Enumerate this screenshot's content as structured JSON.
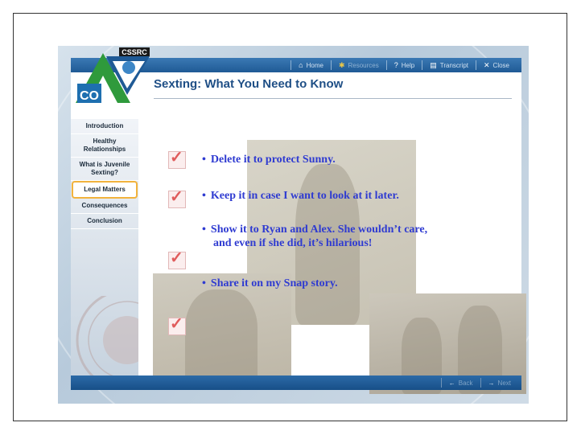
{
  "topnav": [
    {
      "icon": "home-icon",
      "glyph": "⌂",
      "label": "Home"
    },
    {
      "icon": "resources-icon",
      "glyph": "✱",
      "label": "Resources"
    },
    {
      "icon": "help-icon",
      "glyph": "?",
      "label": "Help"
    },
    {
      "icon": "transcript-icon",
      "glyph": "▤",
      "label": "Transcript"
    },
    {
      "icon": "close-icon",
      "glyph": "✕",
      "label": "Close"
    }
  ],
  "logo": {
    "acronym": "CSSRC",
    "state": "CO"
  },
  "page_title": "Sexting: What You Need to Know",
  "sidebar": {
    "items": [
      {
        "label": "Introduction"
      },
      {
        "label": "Healthy Relationships"
      },
      {
        "label": "What is Juvenile Sexting?"
      },
      {
        "label": "Legal Matters"
      },
      {
        "label": "Consequences"
      },
      {
        "label": "Conclusion"
      }
    ]
  },
  "options": [
    {
      "bullet": "•",
      "text": "Delete it to protect Sunny."
    },
    {
      "bullet": "•",
      "text": "Keep it in case I want to look at it later."
    },
    {
      "bullet": "•",
      "text": "Show it to Ryan and Alex. She wouldn’t care,",
      "text2": "and even if she did, it’s hilarious!"
    },
    {
      "bullet": "•",
      "text": "Share it on my Snap story."
    }
  ],
  "bottomnav": [
    {
      "icon": "back-arrow-icon",
      "glyph": "←",
      "label": "Back"
    },
    {
      "icon": "next-arrow-icon",
      "glyph": "→",
      "label": "Next"
    }
  ],
  "colors": {
    "accent": "#1f4f86",
    "option_text": "#2f3bd1",
    "current_section_border": "#f2b33d",
    "check": "#e05c5c"
  }
}
